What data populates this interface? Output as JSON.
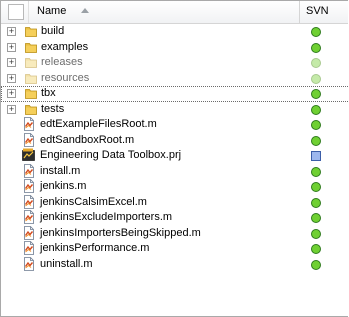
{
  "header": {
    "name_label": "Name",
    "svn_label": "SVN"
  },
  "colors": {
    "svn_ok": "#6fd032",
    "svn_ok_dim": "#c4eaa8",
    "svn_modified": "#9db7ee"
  },
  "rows": [
    {
      "kind": "folder",
      "label": "build",
      "status": "normal-icon"
    },
    {
      "kind": "folder",
      "label": "examples",
      "status": "normal-icon"
    },
    {
      "kind": "folder",
      "label": "releases",
      "status": "normal-icon",
      "dim": true
    },
    {
      "kind": "folder",
      "label": "resources",
      "status": "normal-icon",
      "dim": true
    },
    {
      "kind": "folder",
      "label": "tbx",
      "status": "normal-icon",
      "boxed": true
    },
    {
      "kind": "folder",
      "label": "tests",
      "status": "normal-icon"
    },
    {
      "kind": "m-file",
      "label": "edtExampleFilesRoot.m",
      "status": "normal-icon"
    },
    {
      "kind": "m-file",
      "label": "edtSandboxRoot.m",
      "status": "normal-icon"
    },
    {
      "kind": "prj-file",
      "label": "Engineering Data Toolbox.prj",
      "status": "modified-icon"
    },
    {
      "kind": "m-file",
      "label": "install.m",
      "status": "normal-icon"
    },
    {
      "kind": "m-file",
      "label": "jenkins.m",
      "status": "normal-icon"
    },
    {
      "kind": "m-file",
      "label": "jenkinsCalsimExcel.m",
      "status": "normal-icon"
    },
    {
      "kind": "m-file",
      "label": "jenkinsExcludeImporters.m",
      "status": "normal-icon"
    },
    {
      "kind": "m-file",
      "label": "jenkinsImportersBeingSkipped.m",
      "status": "normal-icon"
    },
    {
      "kind": "m-file",
      "label": "jenkinsPerformance.m",
      "status": "normal-icon"
    },
    {
      "kind": "m-file",
      "label": "uninstall.m",
      "status": "normal-icon"
    }
  ]
}
